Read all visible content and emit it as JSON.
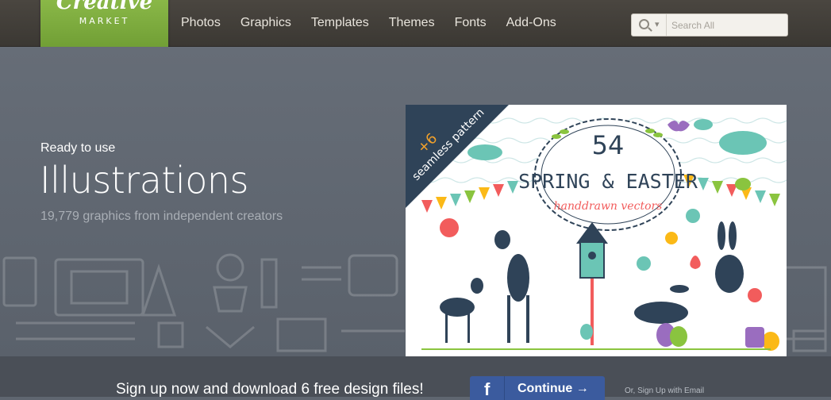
{
  "brand": {
    "logo_script": "Creative",
    "logo_word": "MARKET",
    "color": "#7aaa3c"
  },
  "nav": {
    "items": [
      "Photos",
      "Graphics",
      "Templates",
      "Themes",
      "Fonts",
      "Add-Ons"
    ]
  },
  "search": {
    "placeholder": "Search All",
    "icon": "search-icon",
    "dropdown_icon": "chevron-down-icon"
  },
  "hero": {
    "eyebrow": "Ready to use",
    "heading": "Illustrations",
    "subtext": "19,779 graphics from independent creators",
    "background": "#5f6670"
  },
  "feature_card": {
    "badge_count": "+6",
    "badge_text": "seamless pattern",
    "number": "54",
    "title": "SPRING & EASTER",
    "subtitle": "handdrawn vectors"
  },
  "signup": {
    "message": "Sign up now and download 6 free design files!",
    "fb_icon": "f",
    "fb_button": "Continue →",
    "alt_link": "Or, Sign Up with Email",
    "fb_color": "#3b5b9e"
  }
}
